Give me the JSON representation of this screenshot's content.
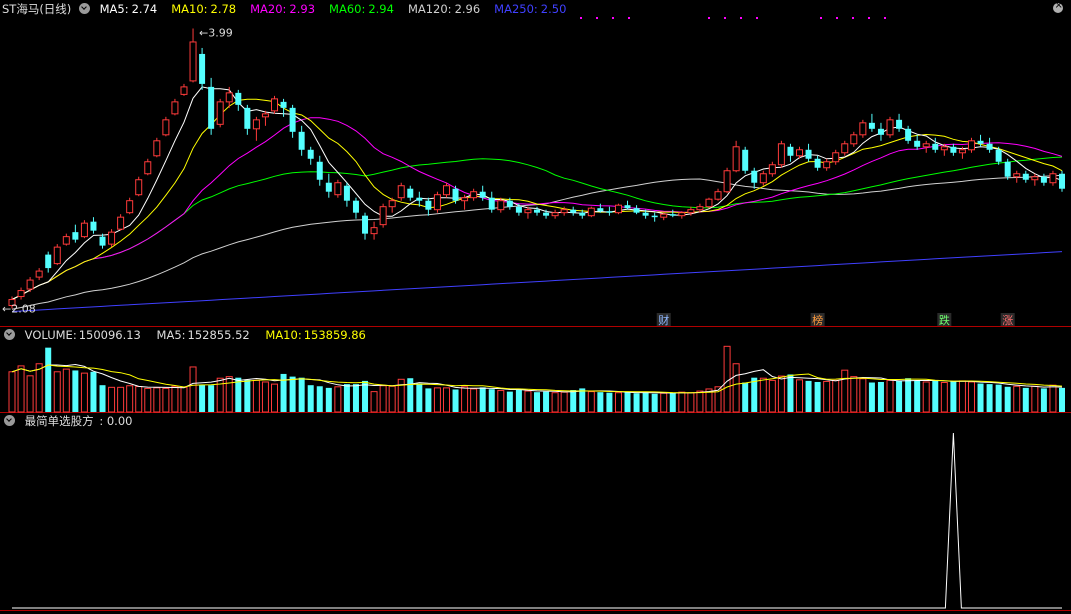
{
  "header": {
    "title": "ST海马(日线)",
    "ma": [
      {
        "label": "MA5:",
        "value": "2.74",
        "color": "#ffffff"
      },
      {
        "label": "MA10:",
        "value": "2.78",
        "color": "#ffff00"
      },
      {
        "label": "MA20:",
        "value": "2.93",
        "color": "#ff00ff"
      },
      {
        "label": "MA60:",
        "value": "2.94",
        "color": "#00ff00"
      },
      {
        "label": "MA120:",
        "value": "2.96",
        "color": "#d0d0d0"
      },
      {
        "label": "MA250:",
        "value": "2.50",
        "color": "#4040ff"
      }
    ]
  },
  "volume_header": {
    "label": "VOLUME:",
    "value": "150096.13",
    "ma5_label": "MA5:",
    "ma5_value": "152855.52",
    "ma10_label": "MA10:",
    "ma10_value": "153859.86"
  },
  "indicator_header": {
    "label": "最简单选股方",
    "value": ": 0.00"
  },
  "annotations": {
    "high": "3.99",
    "low": "2.08"
  },
  "markers": [
    {
      "text": "财",
      "color": "#8fb8ff"
    },
    {
      "text": "榜",
      "color": "#ff9b3d"
    },
    {
      "text": "跌",
      "color": "#6fff6f"
    },
    {
      "text": "涨",
      "color": "#ff6f6f"
    }
  ],
  "colors": {
    "up": "#ff3b3b",
    "down": "#54ffff",
    "separator": "#b00000",
    "ma5": "#ffffff",
    "ma10": "#ffff00",
    "ma20": "#ff00ff",
    "ma60": "#00ff00",
    "ma120": "#d0d0d0",
    "ma250": "#4040ff"
  },
  "chart_data": {
    "type": "candlestick",
    "price_high": 3.99,
    "price_low": 2.08,
    "ohlc": [
      [
        2.14,
        2.2,
        2.12,
        2.18
      ],
      [
        2.2,
        2.26,
        2.18,
        2.24
      ],
      [
        2.25,
        2.33,
        2.23,
        2.31
      ],
      [
        2.33,
        2.39,
        2.31,
        2.37
      ],
      [
        2.48,
        2.5,
        2.36,
        2.39
      ],
      [
        2.42,
        2.55,
        2.41,
        2.53
      ],
      [
        2.55,
        2.62,
        2.54,
        2.6
      ],
      [
        2.63,
        2.68,
        2.56,
        2.58
      ],
      [
        2.6,
        2.71,
        2.59,
        2.69
      ],
      [
        2.7,
        2.73,
        2.62,
        2.64
      ],
      [
        2.6,
        2.62,
        2.52,
        2.54
      ],
      [
        2.55,
        2.65,
        2.53,
        2.63
      ],
      [
        2.65,
        2.75,
        2.64,
        2.73
      ],
      [
        2.76,
        2.86,
        2.75,
        2.84
      ],
      [
        2.88,
        3.0,
        2.87,
        2.98
      ],
      [
        3.02,
        3.12,
        3.01,
        3.1
      ],
      [
        3.14,
        3.26,
        3.13,
        3.24
      ],
      [
        3.28,
        3.4,
        3.27,
        3.38
      ],
      [
        3.42,
        3.52,
        3.41,
        3.5
      ],
      [
        3.55,
        3.62,
        3.54,
        3.6
      ],
      [
        3.64,
        3.99,
        3.63,
        3.9
      ],
      [
        3.82,
        3.86,
        3.58,
        3.62
      ],
      [
        3.6,
        3.66,
        3.28,
        3.32
      ],
      [
        3.35,
        3.52,
        3.33,
        3.5
      ],
      [
        3.5,
        3.6,
        3.46,
        3.56
      ],
      [
        3.56,
        3.58,
        3.44,
        3.48
      ],
      [
        3.46,
        3.48,
        3.28,
        3.32
      ],
      [
        3.32,
        3.4,
        3.24,
        3.38
      ],
      [
        3.4,
        3.44,
        3.34,
        3.42
      ],
      [
        3.44,
        3.54,
        3.42,
        3.52
      ],
      [
        3.5,
        3.52,
        3.4,
        3.46
      ],
      [
        3.46,
        3.48,
        3.26,
        3.3
      ],
      [
        3.3,
        3.34,
        3.14,
        3.18
      ],
      [
        3.18,
        3.2,
        3.08,
        3.12
      ],
      [
        3.1,
        3.14,
        2.94,
        2.98
      ],
      [
        2.96,
        3.02,
        2.86,
        2.9
      ],
      [
        2.88,
        2.98,
        2.86,
        2.96
      ],
      [
        2.94,
        2.96,
        2.8,
        2.84
      ],
      [
        2.84,
        2.86,
        2.72,
        2.76
      ],
      [
        2.74,
        2.76,
        2.58,
        2.62
      ],
      [
        2.62,
        2.7,
        2.58,
        2.66
      ],
      [
        2.68,
        2.82,
        2.66,
        2.8
      ],
      [
        2.8,
        2.86,
        2.76,
        2.84
      ],
      [
        2.86,
        2.96,
        2.84,
        2.94
      ],
      [
        2.92,
        2.94,
        2.84,
        2.86
      ],
      [
        2.86,
        2.9,
        2.8,
        2.84
      ],
      [
        2.84,
        2.86,
        2.74,
        2.78
      ],
      [
        2.78,
        2.9,
        2.76,
        2.88
      ],
      [
        2.88,
        2.96,
        2.86,
        2.94
      ],
      [
        2.92,
        2.94,
        2.82,
        2.84
      ],
      [
        2.84,
        2.88,
        2.78,
        2.86
      ],
      [
        2.86,
        2.92,
        2.84,
        2.9
      ],
      [
        2.9,
        2.94,
        2.84,
        2.86
      ],
      [
        2.86,
        2.9,
        2.76,
        2.78
      ],
      [
        2.78,
        2.86,
        2.76,
        2.84
      ],
      [
        2.84,
        2.86,
        2.78,
        2.8
      ],
      [
        2.8,
        2.82,
        2.74,
        2.76
      ],
      [
        2.76,
        2.8,
        2.72,
        2.78
      ],
      [
        2.78,
        2.8,
        2.74,
        2.76
      ],
      [
        2.76,
        2.78,
        2.72,
        2.74
      ],
      [
        2.74,
        2.78,
        2.72,
        2.76
      ],
      [
        2.76,
        2.8,
        2.74,
        2.78
      ],
      [
        2.78,
        2.8,
        2.74,
        2.76
      ],
      [
        2.76,
        2.78,
        2.72,
        2.74
      ],
      [
        2.74,
        2.8,
        2.73,
        2.79
      ],
      [
        2.79,
        2.82,
        2.76,
        2.77
      ],
      [
        2.77,
        2.8,
        2.74,
        2.76
      ],
      [
        2.76,
        2.82,
        2.75,
        2.81
      ],
      [
        2.81,
        2.84,
        2.78,
        2.79
      ],
      [
        2.79,
        2.81,
        2.75,
        2.76
      ],
      [
        2.76,
        2.78,
        2.72,
        2.74
      ],
      [
        2.74,
        2.76,
        2.7,
        2.73
      ],
      [
        2.73,
        2.76,
        2.71,
        2.75
      ],
      [
        2.75,
        2.78,
        2.73,
        2.74
      ],
      [
        2.74,
        2.77,
        2.72,
        2.76
      ],
      [
        2.76,
        2.8,
        2.74,
        2.78
      ],
      [
        2.78,
        2.82,
        2.76,
        2.8
      ],
      [
        2.8,
        2.86,
        2.79,
        2.85
      ],
      [
        2.85,
        2.92,
        2.84,
        2.9
      ],
      [
        2.9,
        3.06,
        2.89,
        3.04
      ],
      [
        3.04,
        3.24,
        3.03,
        3.2
      ],
      [
        3.18,
        3.2,
        3.02,
        3.04
      ],
      [
        3.04,
        3.06,
        2.92,
        2.96
      ],
      [
        2.96,
        3.04,
        2.94,
        3.02
      ],
      [
        3.02,
        3.1,
        3.0,
        3.08
      ],
      [
        3.08,
        3.24,
        3.06,
        3.22
      ],
      [
        3.2,
        3.22,
        3.1,
        3.14
      ],
      [
        3.14,
        3.2,
        3.12,
        3.18
      ],
      [
        3.18,
        3.22,
        3.1,
        3.12
      ],
      [
        3.12,
        3.14,
        3.04,
        3.06
      ],
      [
        3.06,
        3.12,
        3.04,
        3.1
      ],
      [
        3.1,
        3.18,
        3.08,
        3.16
      ],
      [
        3.16,
        3.24,
        3.14,
        3.22
      ],
      [
        3.22,
        3.3,
        3.2,
        3.28
      ],
      [
        3.28,
        3.38,
        3.26,
        3.36
      ],
      [
        3.36,
        3.42,
        3.3,
        3.32
      ],
      [
        3.32,
        3.36,
        3.24,
        3.28
      ],
      [
        3.28,
        3.4,
        3.26,
        3.38
      ],
      [
        3.38,
        3.42,
        3.3,
        3.32
      ],
      [
        3.32,
        3.34,
        3.22,
        3.24
      ],
      [
        3.24,
        3.28,
        3.18,
        3.2
      ],
      [
        3.2,
        3.24,
        3.16,
        3.22
      ],
      [
        3.22,
        3.26,
        3.16,
        3.18
      ],
      [
        3.18,
        3.22,
        3.14,
        3.2
      ],
      [
        3.2,
        3.22,
        3.14,
        3.16
      ],
      [
        3.16,
        3.2,
        3.12,
        3.18
      ],
      [
        3.18,
        3.26,
        3.16,
        3.24
      ],
      [
        3.24,
        3.28,
        3.2,
        3.22
      ],
      [
        3.22,
        3.26,
        3.16,
        3.18
      ],
      [
        3.18,
        3.2,
        3.08,
        3.1
      ],
      [
        3.1,
        3.12,
        2.98,
        3.0
      ],
      [
        3.0,
        3.04,
        2.96,
        3.02
      ],
      [
        3.02,
        3.04,
        2.96,
        2.98
      ],
      [
        2.98,
        3.02,
        2.94,
        3.0
      ],
      [
        3.0,
        3.02,
        2.94,
        2.96
      ],
      [
        2.96,
        3.04,
        2.94,
        3.02
      ],
      [
        3.02,
        3.04,
        2.9,
        2.92
      ]
    ],
    "volume": [
      150,
      172,
      135,
      180,
      240,
      150,
      160,
      155,
      145,
      150,
      100,
      92,
      92,
      98,
      95,
      88,
      90,
      88,
      96,
      92,
      168,
      102,
      100,
      126,
      132,
      128,
      120,
      118,
      112,
      104,
      142,
      132,
      128,
      100,
      96,
      90,
      94,
      104,
      104,
      116,
      76,
      98,
      96,
      122,
      126,
      106,
      88,
      90,
      90,
      84,
      94,
      86,
      92,
      85,
      80,
      76,
      86,
      78,
      74,
      76,
      72,
      74,
      82,
      88,
      76,
      74,
      72,
      72,
      74,
      70,
      74,
      68,
      70,
      72,
      74,
      72,
      78,
      86,
      94,
      245,
      180,
      110,
      128,
      126,
      118,
      134,
      140,
      120,
      116,
      112,
      114,
      118,
      156,
      132,
      124,
      110,
      112,
      118,
      116,
      126,
      116,
      112,
      118,
      110,
      114,
      116,
      112,
      106,
      104,
      102,
      94,
      96,
      90,
      96,
      88,
      100,
      90
    ],
    "volume_ma5": "152855.52",
    "volume_ma10": "153859.86",
    "indicator": {
      "name": "最简单选股方",
      "value": 0.0,
      "signal_bar_index": 104,
      "signal_value": 1
    }
  }
}
